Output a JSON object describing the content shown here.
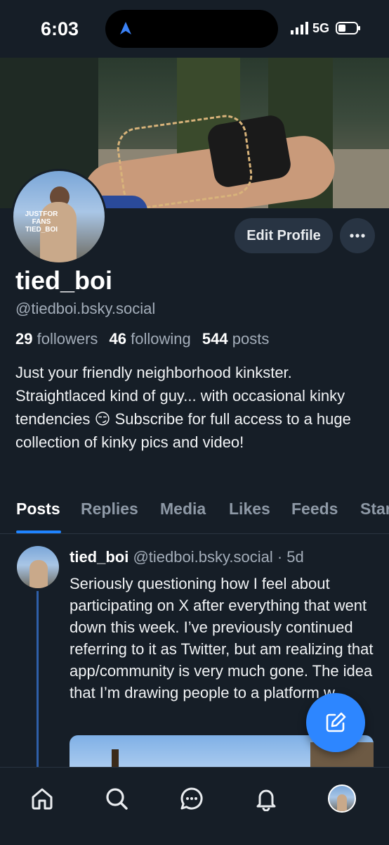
{
  "status_bar": {
    "time": "6:03",
    "network": "5G"
  },
  "profile": {
    "display_name": "tied_boi",
    "handle": "@tiedboi.bsky.social",
    "avatar_watermark_line1": "JUSTFOR FANS",
    "avatar_watermark_line2": "TIED_BOI",
    "followers_count": "29",
    "followers_label": "followers",
    "following_count": "46",
    "following_label": "following",
    "posts_count": "544",
    "posts_label": "posts",
    "bio": "Just your friendly neighborhood kinkster. Straightlaced kind of guy... with occasional kinky tendencies 😏 Subscribe for full access to a huge collection of kinky pics and video!",
    "edit_button_label": "Edit Profile"
  },
  "tabs": [
    {
      "label": "Posts",
      "active": true
    },
    {
      "label": "Replies"
    },
    {
      "label": "Media"
    },
    {
      "label": "Likes"
    },
    {
      "label": "Feeds"
    },
    {
      "label": "Starter Packs"
    }
  ],
  "post": {
    "author": "tied_boi",
    "handle": "@tiedboi.bsky.social",
    "separator": "·",
    "age": "5d",
    "text": "Seriously questioning how I feel about participating on X after everything that went down this week. I’ve previously continued referring to it as Twitter, but am realizing that app/community is very much gone. The idea that I’m drawing people to a platform w"
  },
  "icons": {
    "nav": [
      "home-icon",
      "search-icon",
      "chat-icon",
      "bell-icon",
      "profile-avatar"
    ],
    "fab": "compose-icon",
    "more": "ellipsis-icon"
  },
  "colors": {
    "background": "#161e27",
    "accent": "#1f84ff",
    "fab": "#2d86ff",
    "muted_text": "#a3adb9"
  }
}
